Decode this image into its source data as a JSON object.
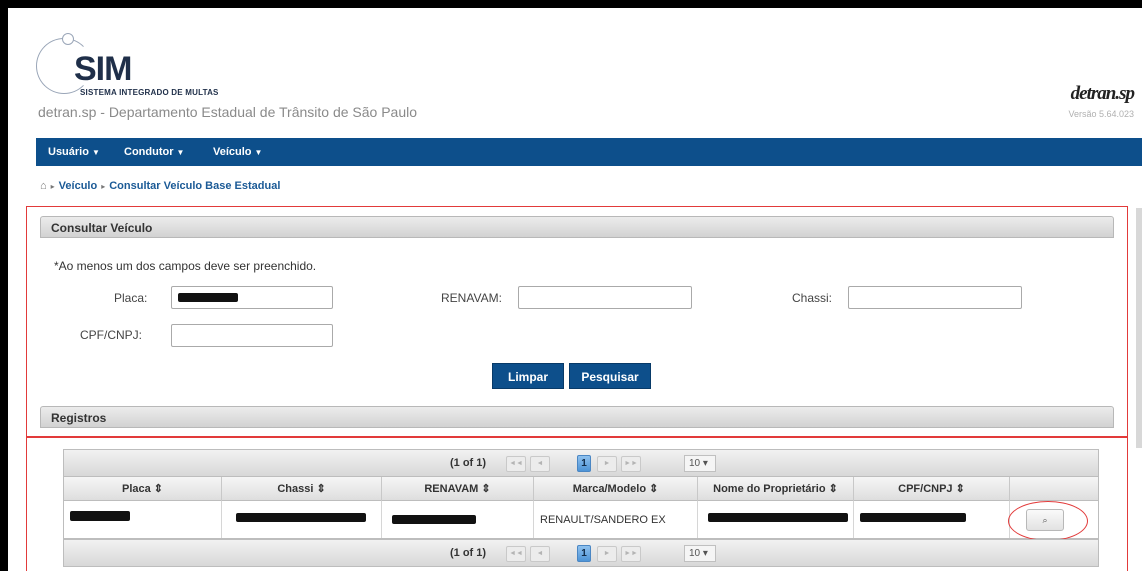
{
  "header": {
    "logo_text": "SIM",
    "logo_subtitle": "SISTEMA INTEGRADO DE MULTAS",
    "subtitle": "detran.sp - Departamento Estadual de Trânsito de São Paulo",
    "brand": "detran.sp",
    "version": "Versão 5.64.023"
  },
  "nav": {
    "items": [
      {
        "label": "Usuário"
      },
      {
        "label": "Condutor"
      },
      {
        "label": "Veículo"
      }
    ]
  },
  "breadcrumb": {
    "home_icon": "home-icon",
    "items": [
      "Veículo",
      "Consultar Veículo Base Estadual"
    ]
  },
  "search_panel": {
    "title": "Consultar Veículo",
    "note": "*Ao menos um dos campos deve ser preenchido.",
    "fields": {
      "placa_label": "Placa:",
      "renavam_label": "RENAVAM:",
      "chassi_label": "Chassi:",
      "cpf_label": "CPF/CNPJ:"
    },
    "buttons": {
      "clear": "Limpar",
      "search": "Pesquisar"
    }
  },
  "results_panel": {
    "title": "Registros",
    "pager": {
      "page_info": "(1 of 1)",
      "current_page": "1",
      "rows_per_page": "10 ▾",
      "first": "◄◄",
      "prev": "◄",
      "next": "►",
      "last": "►►"
    },
    "columns": [
      "Placa ⇕",
      "Chassi ⇕",
      "RENAVAM ⇕",
      "Marca/Modelo ⇕",
      "Nome do Proprietário ⇕",
      "CPF/CNPJ ⇕",
      ""
    ],
    "rows": [
      {
        "marca_modelo": "RENAULT/SANDERO EX",
        "action_icon": "magnifier-icon"
      }
    ]
  },
  "colors": {
    "nav_bg": "#0d4f8b",
    "annotation_red": "#e23a3a",
    "link_blue": "#1b5a96"
  }
}
